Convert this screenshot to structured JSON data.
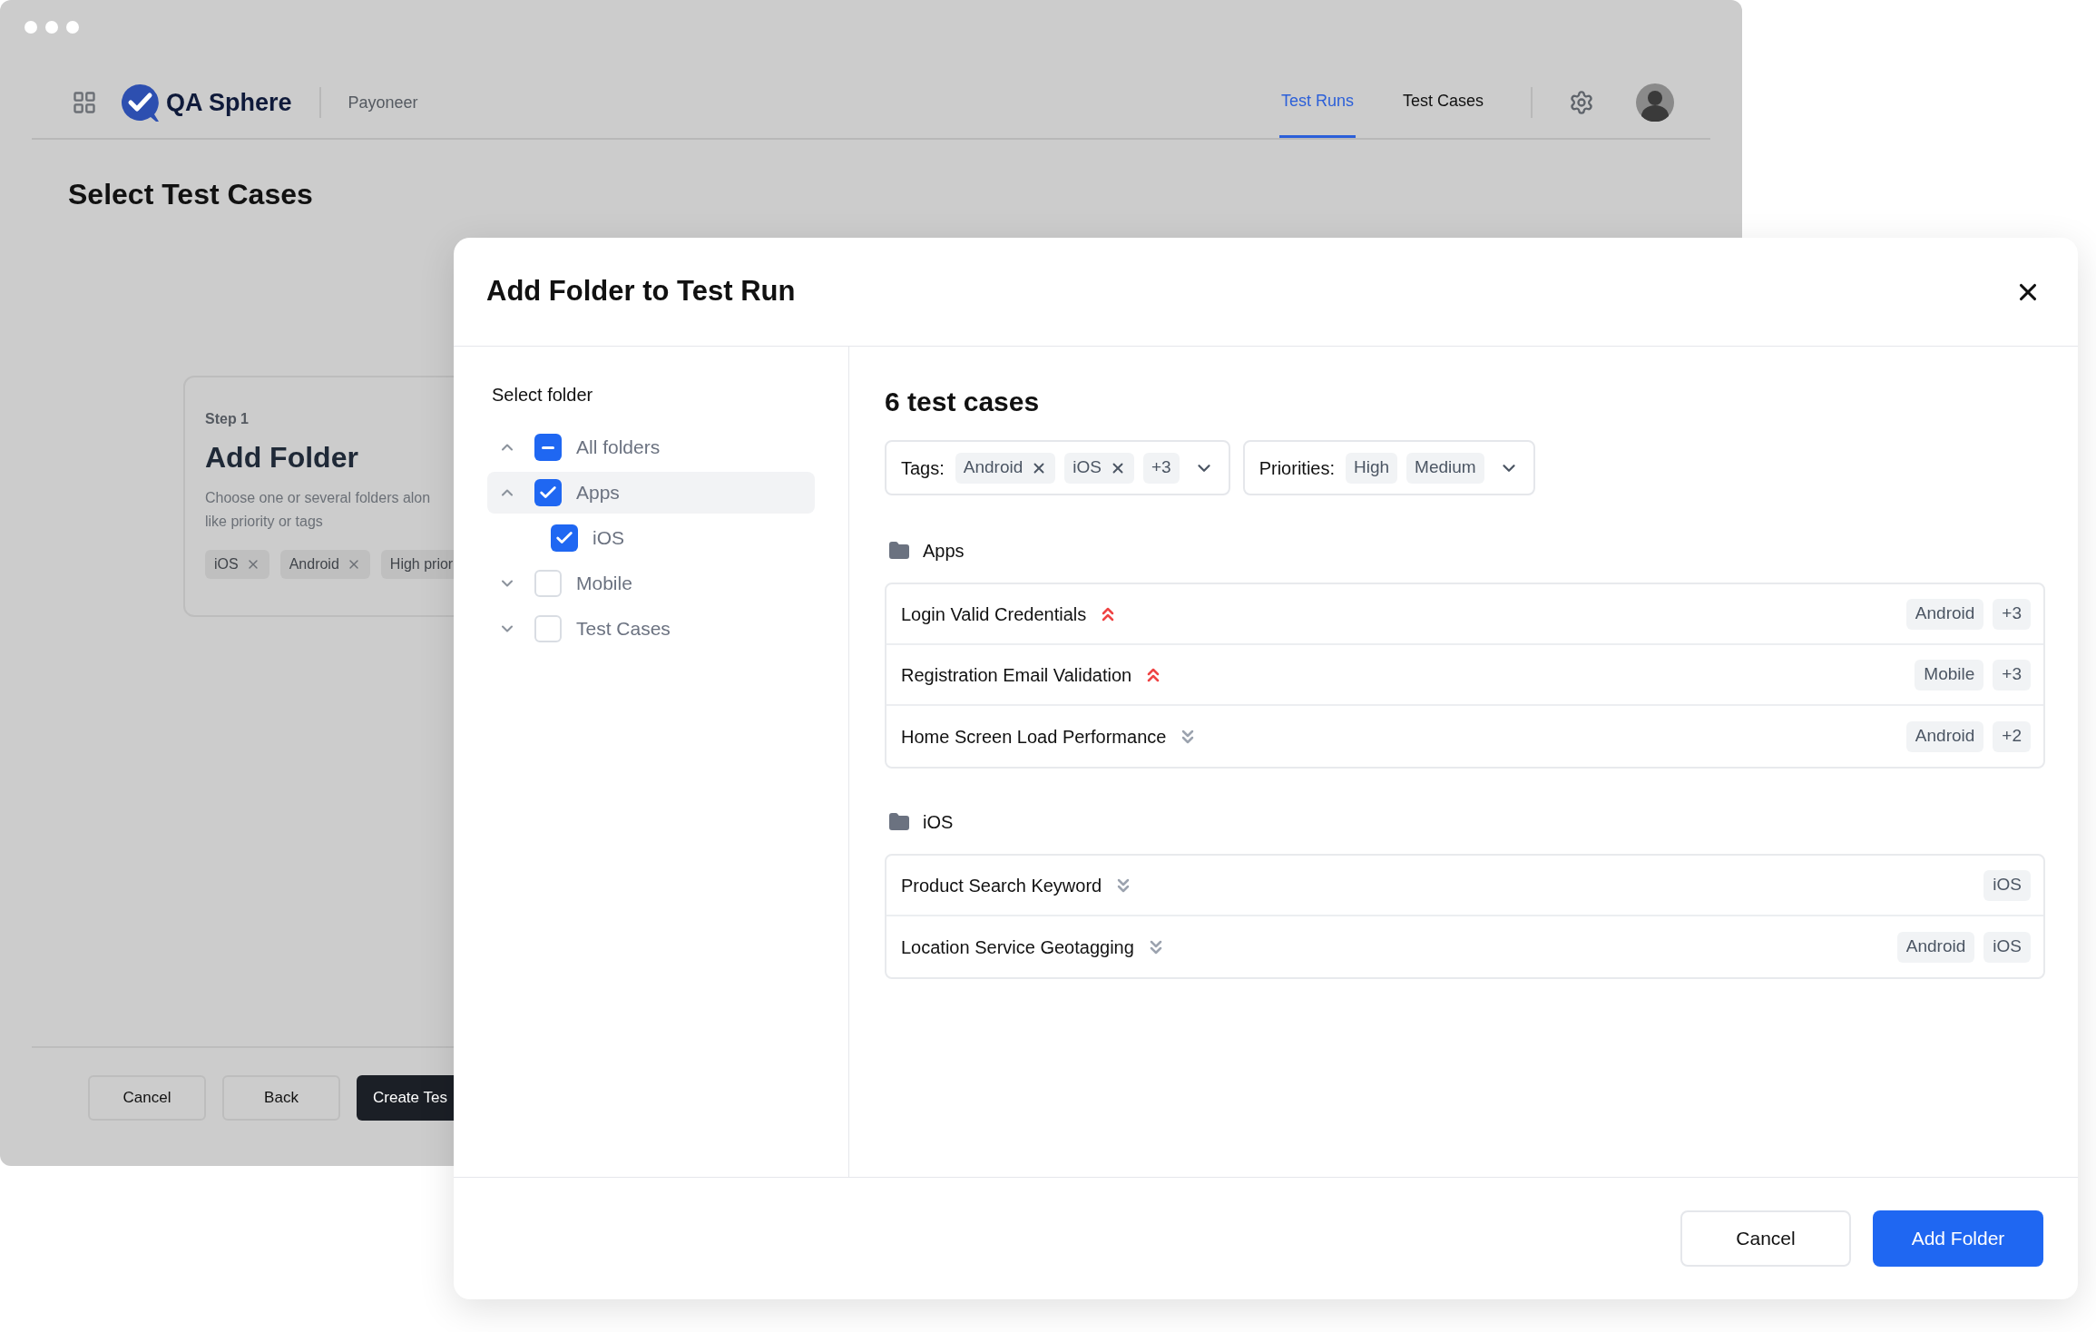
{
  "background_window": {
    "brand": "QA Sphere",
    "workspace": "Payoneer",
    "nav": [
      {
        "label": "Test Runs",
        "selected": true
      },
      {
        "label": "Test Cases",
        "selected": false
      }
    ],
    "page_title": "Select Test Cases",
    "step_card": {
      "step": "Step 1",
      "title": "Add Folder",
      "description_lines": [
        "Choose one or several folders alon",
        "like priority or tags"
      ],
      "chips": [
        {
          "text": "iOS",
          "removable": true
        },
        {
          "text": "Android",
          "removable": true
        },
        {
          "text": "High prior",
          "removable": false
        }
      ]
    },
    "footer_buttons": [
      {
        "label": "Cancel",
        "kind": "secondary"
      },
      {
        "label": "Back",
        "kind": "secondary"
      },
      {
        "label": "Create Tes",
        "kind": "primary"
      }
    ]
  },
  "modal": {
    "title": "Add Folder to Test Run",
    "folder_panel": {
      "heading": "Select folder",
      "tree": [
        {
          "label": "All folders",
          "expanded": true,
          "checked": false,
          "indeterminate": true,
          "selected": false
        },
        {
          "label": "Apps",
          "expanded": true,
          "checked": true,
          "indeterminate": false,
          "selected": true,
          "children": [
            {
              "label": "iOS",
              "checked": true,
              "indeterminate": false,
              "selected": false
            }
          ]
        },
        {
          "label": "Mobile",
          "expanded": false,
          "checked": false,
          "indeterminate": false,
          "selected": false
        },
        {
          "label": "Test Cases",
          "expanded": false,
          "checked": false,
          "indeterminate": false,
          "selected": false
        }
      ]
    },
    "results": {
      "count": "6 test cases",
      "filters": [
        {
          "label": "Tags:",
          "chips": [
            {
              "text": "Android",
              "removable": true
            },
            {
              "text": "iOS",
              "removable": true
            },
            {
              "text": "+3",
              "removable": false
            }
          ]
        },
        {
          "label": "Priorities:",
          "chips": [
            {
              "text": "High",
              "removable": false
            },
            {
              "text": "Medium",
              "removable": false
            }
          ]
        }
      ],
      "groups": [
        {
          "folder": "Apps",
          "cases": [
            {
              "title": "Login Valid Credentials",
              "kind": "high",
              "tags": [
                "Android",
                "+3"
              ]
            },
            {
              "title": "Registration Email Validation",
              "kind": "high",
              "tags": [
                "Mobile",
                "+3"
              ]
            },
            {
              "title": "Home Screen Load Performance",
              "kind": "low",
              "tags": [
                "Android",
                "+2"
              ]
            }
          ]
        },
        {
          "folder": "iOS",
          "cases": [
            {
              "title": "Product Search Keyword",
              "kind": "low",
              "tags": [
                "iOS"
              ]
            },
            {
              "title": "Location Service Geotagging",
              "kind": "low",
              "tags": [
                "Android",
                "iOS"
              ]
            }
          ]
        }
      ]
    },
    "footer_buttons": [
      {
        "label": "Cancel",
        "kind": "secondary"
      },
      {
        "label": "Add Folder",
        "kind": "primary"
      }
    ]
  }
}
